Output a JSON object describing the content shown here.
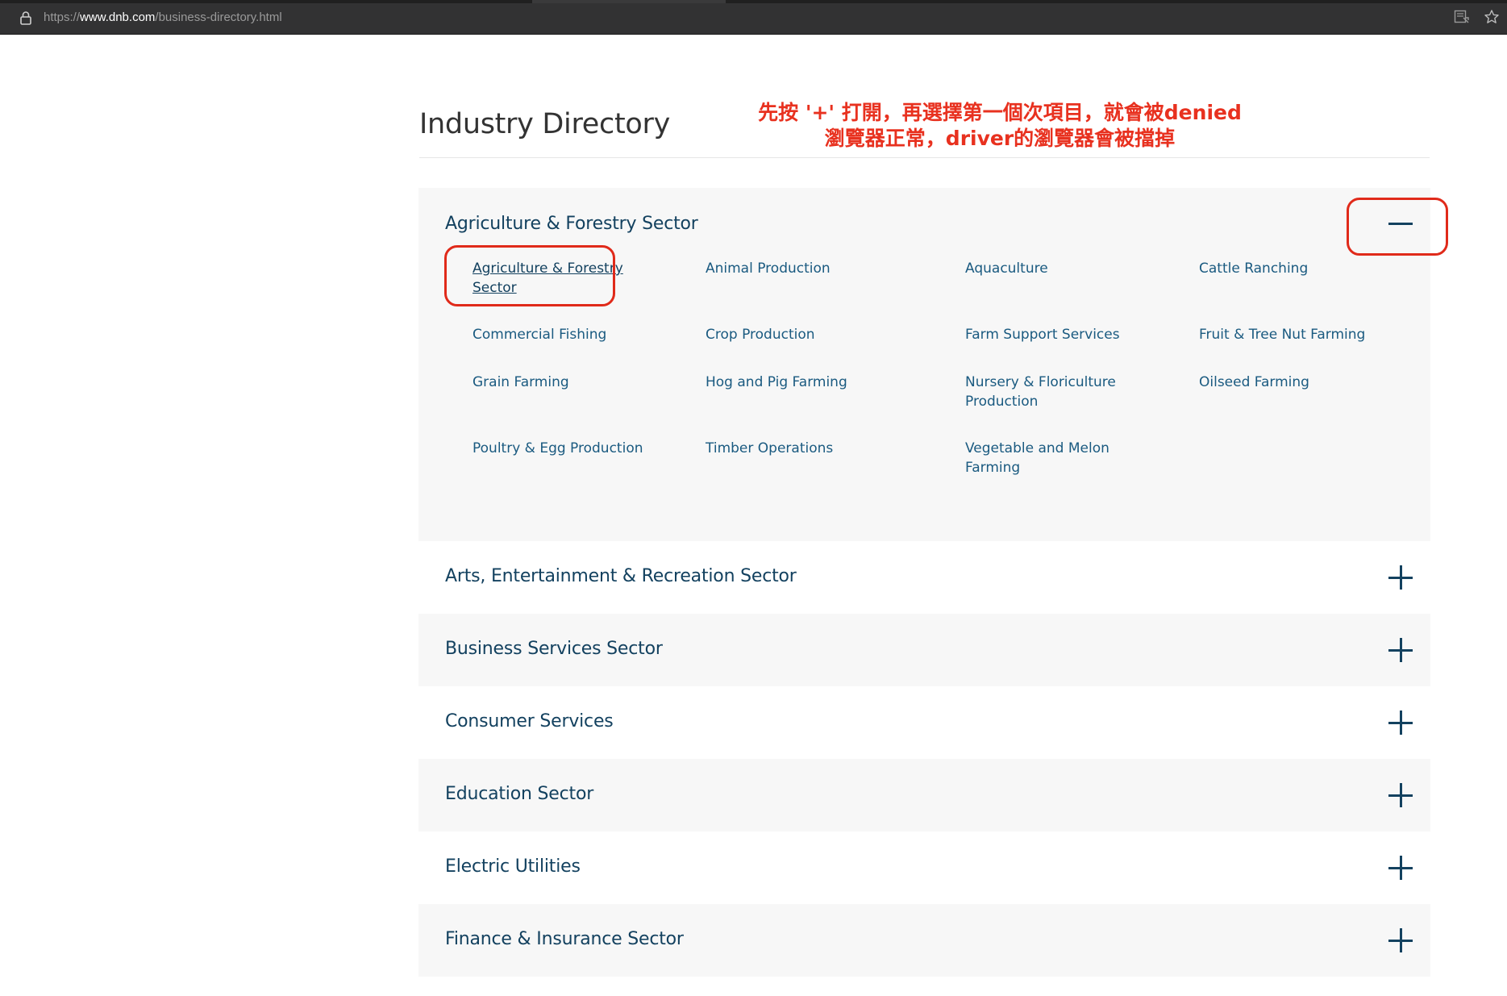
{
  "browser": {
    "url_scheme": "https://",
    "url_host": "www.dnb.com",
    "url_path": "/business-directory.html"
  },
  "page": {
    "title": "Industry Directory",
    "annotation_line1": "先按 '+' 打開，再選擇第一個次項目，就會被denied",
    "annotation_line2": "瀏覽器正常，driver的瀏覽器會被擋掉"
  },
  "expanded_sector": {
    "title": "Agriculture & Forestry Sector",
    "toggle_icon": "minus-icon",
    "subsectors": [
      "Agriculture & Forestry Sector",
      "Animal Production",
      "Aquaculture",
      "Cattle Ranching",
      "Commercial Fishing",
      "Crop Production",
      "Farm Support Services",
      "Fruit & Tree Nut Farming",
      "Grain Farming",
      "Hog and Pig Farming",
      "Nursery & Floriculture Production",
      "Oilseed Farming",
      "Poultry & Egg Production",
      "Timber Operations",
      "Vegetable and Melon Farming"
    ]
  },
  "collapsed_sectors": [
    "Arts, Entertainment & Recreation Sector",
    "Business Services Sector",
    "Consumer Services",
    "Education Sector",
    "Electric Utilities",
    "Finance & Insurance Sector"
  ],
  "colors": {
    "accent": "#13415f",
    "link": "#1a5a80",
    "annotation": "#e8311f",
    "panel_gray": "#f7f7f7"
  }
}
